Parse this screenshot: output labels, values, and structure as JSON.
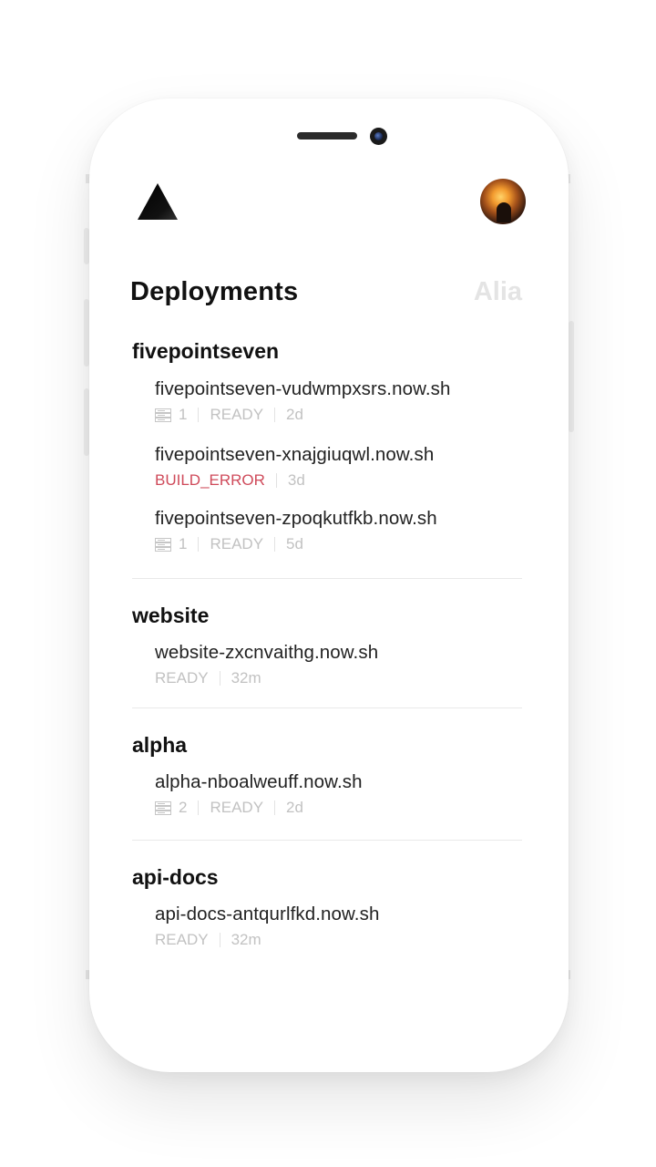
{
  "header": {
    "logo_icon": "triangle-logo-icon",
    "avatar_icon": "user-avatar"
  },
  "tabs": {
    "active": "Deployments",
    "inactive": "Alia"
  },
  "colors": {
    "error": "#cf4a5a",
    "muted": "#c2c2c2",
    "text": "#111111"
  },
  "groups": [
    {
      "name": "fivepointseven",
      "deployments": [
        {
          "url": "fivepointseven-vudwmpxsrs.now.sh",
          "instances": "1",
          "state": "READY",
          "age": "2d"
        },
        {
          "url": "fivepointseven-xnajgiuqwl.now.sh",
          "state": "BUILD_ERROR",
          "age": "3d"
        },
        {
          "url": "fivepointseven-zpoqkutfkb.now.sh",
          "instances": "1",
          "state": "READY",
          "age": "5d"
        }
      ]
    },
    {
      "name": "website",
      "deployments": [
        {
          "url": "website-zxcnvaithg.now.sh",
          "state": "READY",
          "age": "32m"
        }
      ]
    },
    {
      "name": "alpha",
      "deployments": [
        {
          "url": "alpha-nboalweuff.now.sh",
          "instances": "2",
          "state": "READY",
          "age": "2d"
        }
      ]
    },
    {
      "name": "api-docs",
      "deployments": [
        {
          "url": "api-docs-antqurlfkd.now.sh",
          "state": "READY",
          "age": "32m"
        }
      ]
    }
  ]
}
